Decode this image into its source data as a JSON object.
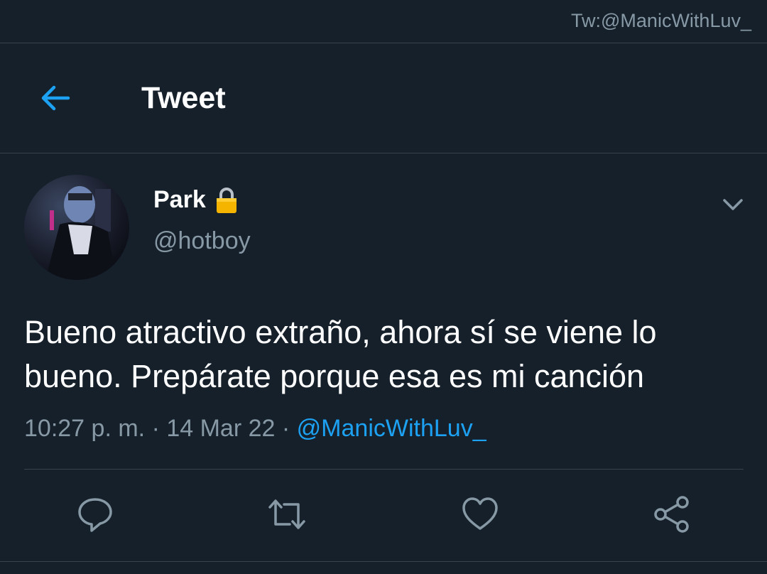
{
  "watermark": "Tw:@ManicWithLuv_",
  "header": {
    "title": "Tweet",
    "back_icon": "arrow-left-icon"
  },
  "author": {
    "name": "Park",
    "lock_icon": "padlock-icon",
    "handle": "@hotboy",
    "menu_icon": "chevron-down-icon"
  },
  "tweet": {
    "text_line1": "Bueno atractivo extraño, ahora sí se viene lo",
    "text_line2": "bueno. Prepárate porque esa es mi canción",
    "time": "10:27 p. m.",
    "date": "14 Mar 22",
    "via": "@ManicWithLuv_"
  },
  "actions": [
    {
      "icon": "reply-icon"
    },
    {
      "icon": "retweet-icon"
    },
    {
      "icon": "like-icon"
    },
    {
      "icon": "share-icon"
    }
  ],
  "colors": {
    "background": "#15202b",
    "accent": "#1da1f2",
    "secondary_text": "#8899a6",
    "divider": "#38444d",
    "lock": "#f5b400"
  }
}
